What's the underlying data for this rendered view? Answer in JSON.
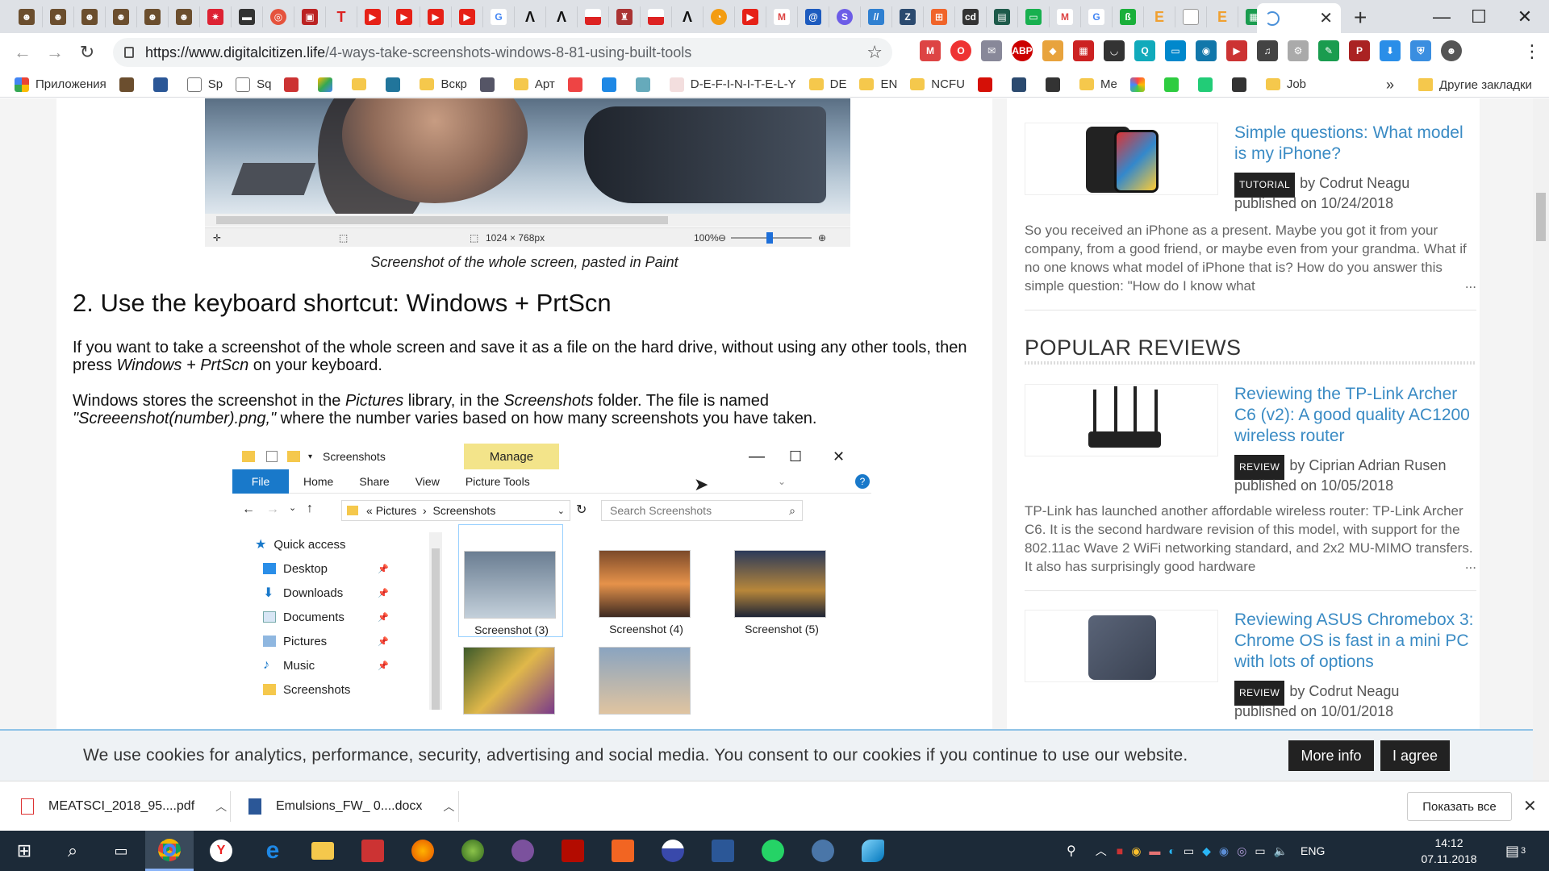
{
  "browser": {
    "active_tab_close": "✕",
    "new_tab": "+",
    "url_host": "https://www.digitalcitizen.life",
    "url_path": "/4-ways-take-screenshots-windows-8-81-using-built-tools",
    "window_controls": {
      "minimize": "—",
      "maximize": "☐",
      "close": "✕"
    }
  },
  "bookmarks": [
    {
      "label": "Приложения",
      "icon": "apps-grid-icon"
    },
    {
      "label": "",
      "icon": "avatar-icon"
    },
    {
      "label": "",
      "icon": "word-icon"
    },
    {
      "label": "Sp",
      "icon": "page-icon"
    },
    {
      "label": "Sq",
      "icon": "page-icon"
    },
    {
      "label": "",
      "icon": "wf-icon"
    },
    {
      "label": "",
      "icon": "drive-icon"
    },
    {
      "label": "",
      "icon": "folder-icon"
    },
    {
      "label": "",
      "icon": "wordpress-icon"
    },
    {
      "label": "Вскр",
      "icon": "folder-icon"
    },
    {
      "label": "",
      "icon": "puzzle-icon"
    },
    {
      "label": "Арт",
      "icon": "folder-icon"
    },
    {
      "label": "",
      "icon": "yandex-icon"
    },
    {
      "label": "",
      "icon": "swoosh-icon"
    },
    {
      "label": "",
      "icon": "cloud-icon"
    },
    {
      "label": "D-E-F-I-N-I-T-E-L-Y",
      "icon": "blank-icon"
    },
    {
      "label": "DE",
      "icon": "folder-icon"
    },
    {
      "label": "EN",
      "icon": "folder-icon"
    },
    {
      "label": "NCFU",
      "icon": "folder-icon"
    },
    {
      "label": "",
      "icon": "lastfm-icon"
    },
    {
      "label": "",
      "icon": "chart-icon"
    },
    {
      "label": "",
      "icon": "sound-icon"
    },
    {
      "label": "Me",
      "icon": "folder-icon"
    },
    {
      "label": "",
      "icon": "color-icon"
    },
    {
      "label": "",
      "icon": "bolt-icon"
    },
    {
      "label": "",
      "icon": "gear-icon"
    },
    {
      "label": "",
      "icon": "car-icon"
    },
    {
      "label": "Job",
      "icon": "folder-icon"
    }
  ],
  "bookmarks_more": "»",
  "bookmarks_other": "Другие закладки",
  "article": {
    "paint_status": {
      "size": "1024 × 768px",
      "zoom": "100%"
    },
    "caption": "Screenshot of the whole screen, pasted in Paint",
    "heading": "2. Use the keyboard shortcut: Windows + PrtScn",
    "para1_a": "If you want to take a screenshot of the whole screen and save it as a file on the hard drive, without using any other tools, then press ",
    "para1_em": "Windows + PrtScn",
    "para1_b": " on your keyboard.",
    "para2_a": "Windows stores the screenshot in the ",
    "para2_em1": "Pictures",
    "para2_b": " library, in the ",
    "para2_em2": "Screenshots",
    "para2_c": " folder. The file is named ",
    "para2_em3": "\"Screeenshot(number).png,\"",
    "para2_d": " where the number varies based on how many screenshots you have taken."
  },
  "explorer": {
    "title": "Screenshots",
    "manage": "Manage",
    "ribbon": [
      "File",
      "Home",
      "Share",
      "View",
      "Picture Tools"
    ],
    "address": [
      "Pictures",
      "Screenshots"
    ],
    "search_placeholder": "Search Screenshots",
    "nav": [
      "Quick access",
      "Desktop",
      "Downloads",
      "Documents",
      "Pictures",
      "Music",
      "Screenshots"
    ],
    "files": [
      "Screenshot (3)",
      "Screenshot (4)",
      "Screenshot (5)"
    ]
  },
  "sidebar": {
    "card1": {
      "title": "Simple questions: What model is my iPhone?",
      "badge": "TUTORIAL",
      "by": "by Codrut Neagu",
      "date": "published on 10/24/2018",
      "desc": "So you received an iPhone as a present. Maybe you got it from your company, from a good friend, or maybe even from your grandma. What if no one knows what model of iPhone that is? How do you answer this simple question: \"How do I know what"
    },
    "section": "POPULAR REVIEWS",
    "card2": {
      "title": "Reviewing the TP-Link Archer C6 (v2): A good quality AC1200 wireless router",
      "badge": "REVIEW",
      "by": "by Ciprian Adrian Rusen",
      "date": "published on 10/05/2018",
      "desc": "TP-Link has launched another affordable wireless router: TP-Link Archer C6. It is the second hardware revision of this model, with support for the 802.11ac Wave 2 WiFi networking standard, and 2x2 MU-MIMO transfers. It also has surprisingly good hardware"
    },
    "card3": {
      "title": "Reviewing ASUS Chromebox 3: Chrome OS is fast in a mini PC with lots of options",
      "badge": "REVIEW",
      "by": "by Codrut Neagu",
      "date": "published on 10/01/2018"
    },
    "ellipsis": "..."
  },
  "cookie": {
    "text": "We use cookies for analytics, performance, security, advertising and social media. You consent to our cookies if you continue to use our website.",
    "more": "More info",
    "agree": "I agree"
  },
  "downloads": {
    "items": [
      "MEATSCI_2018_95....pdf",
      "Emulsions_FW_ 0....docx"
    ],
    "show_all": "Показать все"
  },
  "taskbar": {
    "lang": "ENG",
    "time": "14:12",
    "date": "07.11.2018",
    "notifications": "3"
  }
}
